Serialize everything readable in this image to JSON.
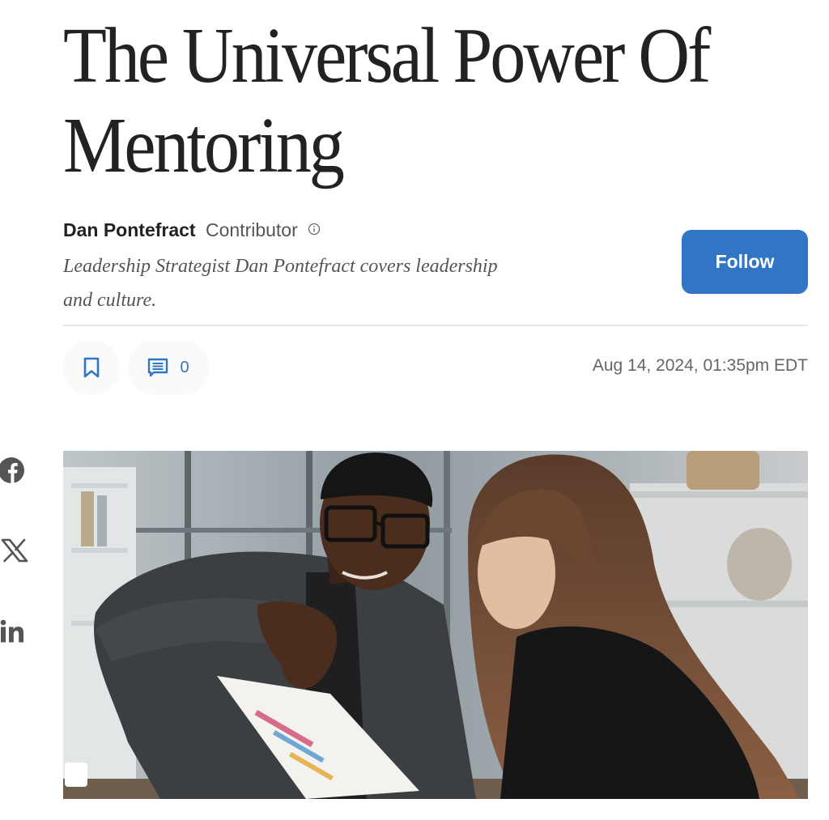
{
  "article": {
    "title_line1": "The Universal Power Of",
    "title_line2": "Mentoring"
  },
  "author": {
    "name": "Dan Pontefract",
    "role": "Contributor",
    "bio": "Leadership Strategist Dan Pontefract covers leadership and culture."
  },
  "actions": {
    "follow_label": "Follow",
    "comment_count": "0",
    "publish_date": "Aug 14, 2024, 01:35pm EDT"
  },
  "icons": {
    "info": "info-icon",
    "bookmark": "bookmark-icon",
    "comment": "comment-icon",
    "facebook": "facebook-icon",
    "x": "x-icon",
    "linkedin": "linkedin-icon"
  },
  "colors": {
    "accent": "#3176c4",
    "headline": "#222222",
    "muted": "#555555"
  }
}
